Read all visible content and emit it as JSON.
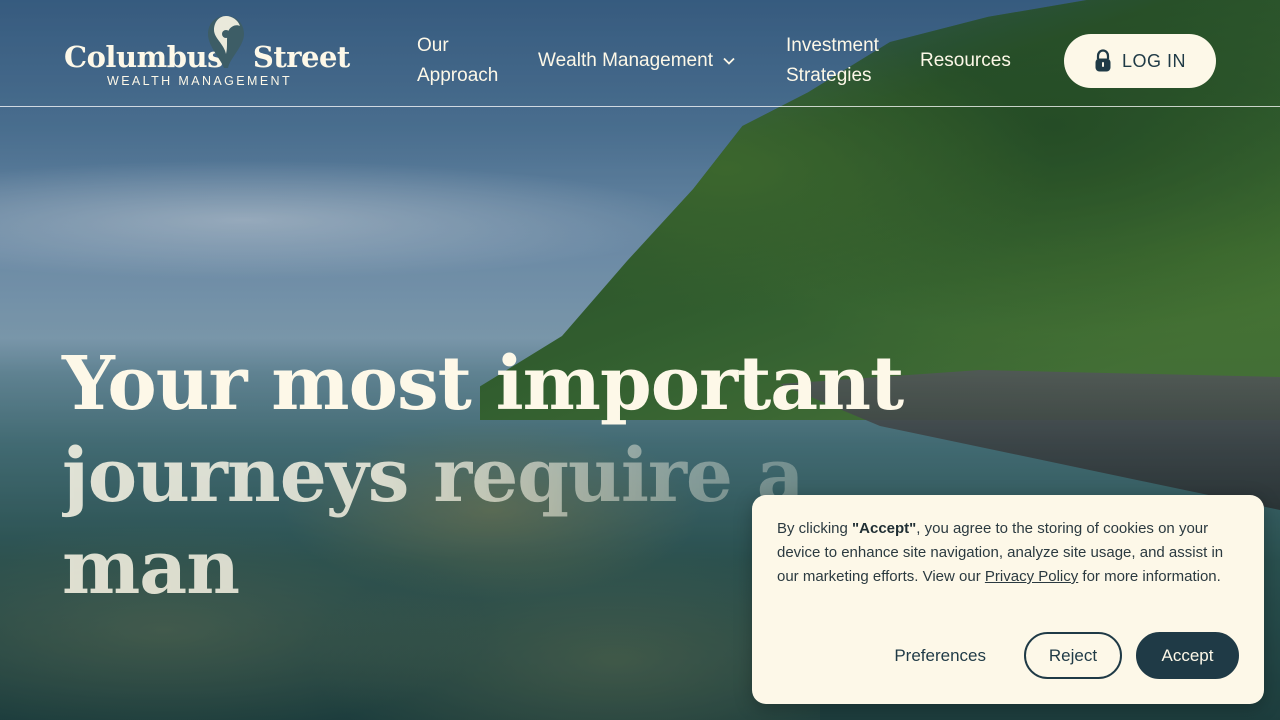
{
  "brand": {
    "name_left": "Columbus",
    "name_right": "Street",
    "tagline": "WEALTH MANAGEMENT"
  },
  "nav": {
    "approach_line1": "Our",
    "approach_line2": "Approach",
    "wealth_management": "Wealth Management",
    "investment_line1": "Investment",
    "investment_line2": "Strategies",
    "resources": "Resources",
    "login": "LOG IN"
  },
  "hero": {
    "line1": "Your most important",
    "line2": "journeys require a man"
  },
  "cookie": {
    "text_before": "By clicking ",
    "accept_quoted": "\"Accept\"",
    "text_middle": ", you agree to the storing of cookies on your device to enhance site navigation, analyze site usage, and assist in our marketing efforts. View our ",
    "privacy_link": "Privacy Policy",
    "text_after": " for more information.",
    "preferences": "Preferences",
    "reject": "Reject",
    "accept": "Accept"
  },
  "colors": {
    "cream": "#fdf8e8",
    "dark_teal": "#1f3a46",
    "logo_pin": "#3d5d66"
  },
  "icons": {
    "logo": "map-pin-icon",
    "login": "lock-icon",
    "dropdown": "chevron-down-icon"
  }
}
